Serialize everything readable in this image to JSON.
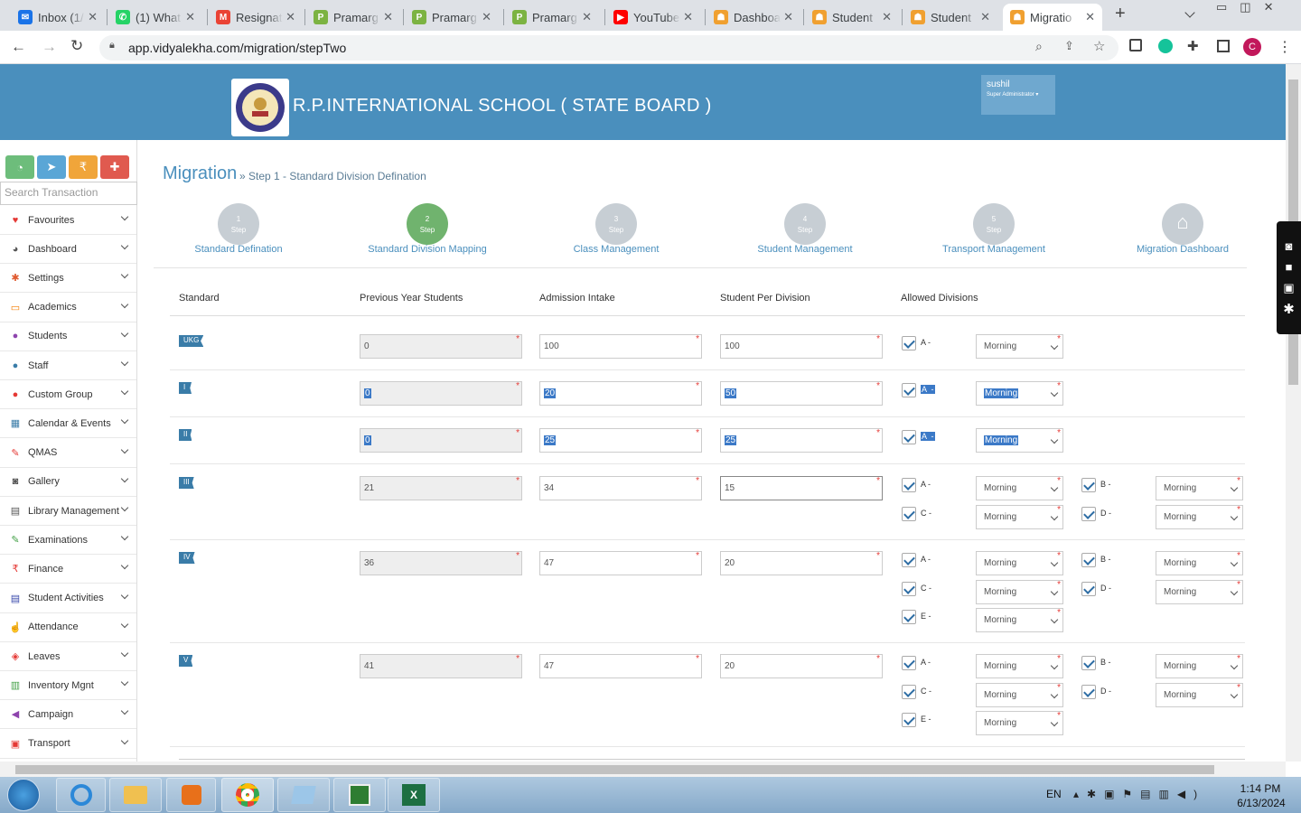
{
  "browser": {
    "tabs": [
      {
        "title": "Inbox (1/",
        "color": "#1a73e8",
        "glyph": "✉"
      },
      {
        "title": "(1) What",
        "color": "#25d366",
        "glyph": "✆"
      },
      {
        "title": "Resignat",
        "color": "#ea4335",
        "glyph": "M"
      },
      {
        "title": "Pramarg",
        "color": "#7cb342",
        "glyph": "P"
      },
      {
        "title": "Pramarg",
        "color": "#7cb342",
        "glyph": "P"
      },
      {
        "title": "Pramarg",
        "color": "#7cb342",
        "glyph": "P"
      },
      {
        "title": "YouTube",
        "color": "#ff0000",
        "glyph": "▶"
      },
      {
        "title": "Dashboa",
        "color": "#f0a030",
        "glyph": "☗"
      },
      {
        "title": "Student",
        "color": "#f0a030",
        "glyph": "☗"
      },
      {
        "title": "Student",
        "color": "#f0a030",
        "glyph": "☗"
      },
      {
        "title": "Migratio",
        "color": "#f0a030",
        "glyph": "☗"
      }
    ],
    "url": "app.vidyalekha.com/migration/stepTwo",
    "profile_initial": "C"
  },
  "header": {
    "school_name": "R.P.INTERNATIONAL SCHOOL ( STATE BOARD )",
    "user_name": "sushil",
    "user_role": "Super Administrator"
  },
  "sidebar": {
    "search_placeholder": "Search Transaction",
    "quick_buttons": [
      {
        "icon": "dashboard-icon",
        "glyph": "◔",
        "color": "#6dbd7b"
      },
      {
        "icon": "send-icon",
        "glyph": "➤",
        "color": "#5aa6d6"
      },
      {
        "icon": "rupee-icon",
        "glyph": "₹",
        "color": "#f0a53a"
      },
      {
        "icon": "add-user-icon",
        "glyph": "✚",
        "color": "#e05a4f"
      }
    ],
    "items": [
      {
        "label": "Favourites",
        "icon": "heart-icon",
        "glyph": "♥",
        "color": "#e53935"
      },
      {
        "label": "Dashboard",
        "icon": "dashboard-icon",
        "glyph": "◕",
        "color": "#555"
      },
      {
        "label": "Settings",
        "icon": "gear-icon",
        "glyph": "✱",
        "color": "#e05a2f"
      },
      {
        "label": "Academics",
        "icon": "laptop-icon",
        "glyph": "▭",
        "color": "#f57c00"
      },
      {
        "label": "Students",
        "icon": "user-icon",
        "glyph": "●",
        "color": "#8e44ad"
      },
      {
        "label": "Staff",
        "icon": "users-icon",
        "glyph": "●",
        "color": "#3a7ca8"
      },
      {
        "label": "Custom Group",
        "icon": "group-icon",
        "glyph": "●",
        "color": "#e53935"
      },
      {
        "label": "Calendar & Events",
        "icon": "calendar-icon",
        "glyph": "▦",
        "color": "#3a7ca8"
      },
      {
        "label": "QMAS",
        "icon": "pencil-icon",
        "glyph": "✎",
        "color": "#e53935"
      },
      {
        "label": "Gallery",
        "icon": "camera-icon",
        "glyph": "◙",
        "color": "#555"
      },
      {
        "label": "Library Management",
        "icon": "book-icon",
        "glyph": "▤",
        "color": "#555"
      },
      {
        "label": "Examinations",
        "icon": "edit-icon",
        "glyph": "✎",
        "color": "#43a047"
      },
      {
        "label": "Finance",
        "icon": "rupee-icon",
        "glyph": "₹",
        "color": "#e53935"
      },
      {
        "label": "Student Activities",
        "icon": "book-icon",
        "glyph": "▤",
        "color": "#3949ab"
      },
      {
        "label": "Attendance",
        "icon": "hand-icon",
        "glyph": "☝",
        "color": "#f57c00"
      },
      {
        "label": "Leaves",
        "icon": "tag-icon",
        "glyph": "◈",
        "color": "#e53935"
      },
      {
        "label": "Inventory Mgnt",
        "icon": "inventory-icon",
        "glyph": "▥",
        "color": "#43a047"
      },
      {
        "label": "Campaign",
        "icon": "megaphone-icon",
        "glyph": "◀",
        "color": "#8e44ad"
      },
      {
        "label": "Transport",
        "icon": "bus-icon",
        "glyph": "▣",
        "color": "#e53935"
      }
    ]
  },
  "page": {
    "title": "Migration",
    "breadcrumb": "» Step 1 - Standard Division Defination"
  },
  "steps": [
    {
      "num": "1",
      "word": "Step",
      "label": "Standard Defination"
    },
    {
      "num": "2",
      "word": "Step",
      "label": "Standard Division Mapping"
    },
    {
      "num": "3",
      "word": "Step",
      "label": "Class Management"
    },
    {
      "num": "4",
      "word": "Step",
      "label": "Student Management"
    },
    {
      "num": "5",
      "word": "Step",
      "label": "Transport Management"
    },
    {
      "num": "",
      "word": "",
      "label": "Migration Dashboard"
    }
  ],
  "table": {
    "headers": [
      "Standard",
      "Previous Year Students",
      "Admission Intake",
      "Student Per Division",
      "Allowed Divisions"
    ],
    "shift_default": "Morning",
    "rows": [
      {
        "standard": "UKG",
        "previous": "0",
        "intake": "100",
        "per_division": "100",
        "divisions": [
          "A"
        ]
      },
      {
        "standard": "I",
        "previous": "0",
        "intake": "20",
        "per_division": "50",
        "divisions": [
          "A"
        ]
      },
      {
        "standard": "II",
        "previous": "0",
        "intake": "25",
        "per_division": "25",
        "divisions": [
          "A"
        ]
      },
      {
        "standard": "III",
        "previous": "21",
        "intake": "34",
        "per_division": "15",
        "divisions": [
          "A",
          "B",
          "C",
          "D"
        ]
      },
      {
        "standard": "IV",
        "previous": "36",
        "intake": "47",
        "per_division": "20",
        "divisions": [
          "A",
          "B",
          "C",
          "D",
          "E"
        ]
      },
      {
        "standard": "V",
        "previous": "41",
        "intake": "47",
        "per_division": "20",
        "divisions": [
          "A",
          "B",
          "C",
          "D",
          "E"
        ]
      }
    ]
  },
  "taskbar": {
    "language": "EN",
    "time": "1:14 PM",
    "date": "6/13/2024"
  }
}
